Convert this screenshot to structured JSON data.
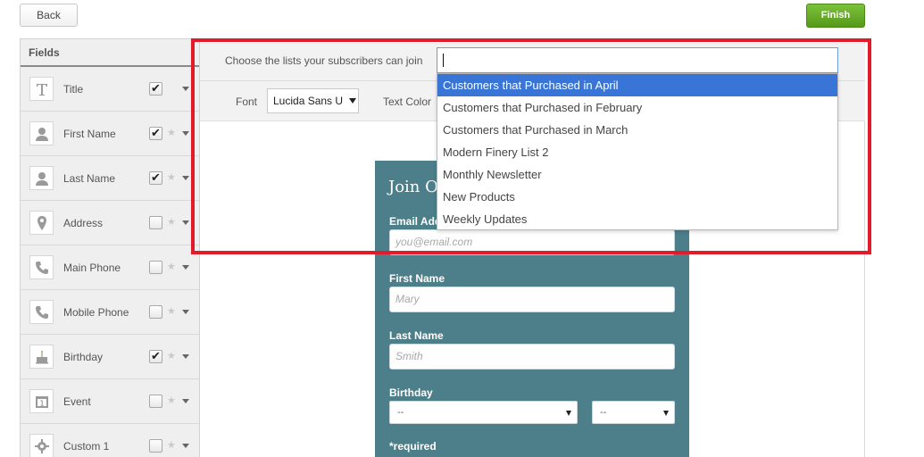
{
  "topbar": {
    "back_label": "Back",
    "finish_label": "Finish"
  },
  "sidebar": {
    "title": "Fields",
    "items": [
      {
        "label": "Title",
        "icon": "text-icon",
        "checked": true,
        "star": false
      },
      {
        "label": "First Name",
        "icon": "person-icon",
        "checked": true,
        "star": true
      },
      {
        "label": "Last Name",
        "icon": "person-icon",
        "checked": true,
        "star": true
      },
      {
        "label": "Address",
        "icon": "map-pin-icon",
        "checked": false,
        "star": true
      },
      {
        "label": "Main Phone",
        "icon": "phone-icon",
        "checked": false,
        "star": true
      },
      {
        "label": "Mobile Phone",
        "icon": "phone-icon",
        "checked": false,
        "star": true
      },
      {
        "label": "Birthday",
        "icon": "cake-icon",
        "checked": true,
        "star": true
      },
      {
        "label": "Event",
        "icon": "calendar-icon",
        "checked": false,
        "star": true
      },
      {
        "label": "Custom 1",
        "icon": "gear-icon",
        "checked": false,
        "star": true
      }
    ]
  },
  "lists": {
    "label": "Choose the lists your subscribers can join",
    "value": "",
    "options": [
      "Customers that Purchased in April",
      "Customers that Purchased in February",
      "Customers that Purchased in March",
      "Modern Finery List 2",
      "Monthly Newsletter",
      "New Products",
      "Weekly Updates"
    ],
    "selected_index": 0
  },
  "style_toolbar": {
    "font_label": "Font",
    "font_value": "Lucida Sans U",
    "text_color_label": "Text Color"
  },
  "form": {
    "title": "Join O",
    "email_label": "Email Add",
    "email_placeholder": "you@email.com",
    "first_name_label": "First Name",
    "first_name_placeholder": "Mary",
    "last_name_label": "Last Name",
    "last_name_placeholder": "Smith",
    "birthday_label": "Birthday",
    "birthday_month": "--",
    "birthday_day": "--",
    "required_note": "*required"
  },
  "colors": {
    "highlight": "#e21b2a",
    "form_background": "#4c7f8a",
    "finish_button": "#6bb22c",
    "selected_option": "#3875d7"
  }
}
